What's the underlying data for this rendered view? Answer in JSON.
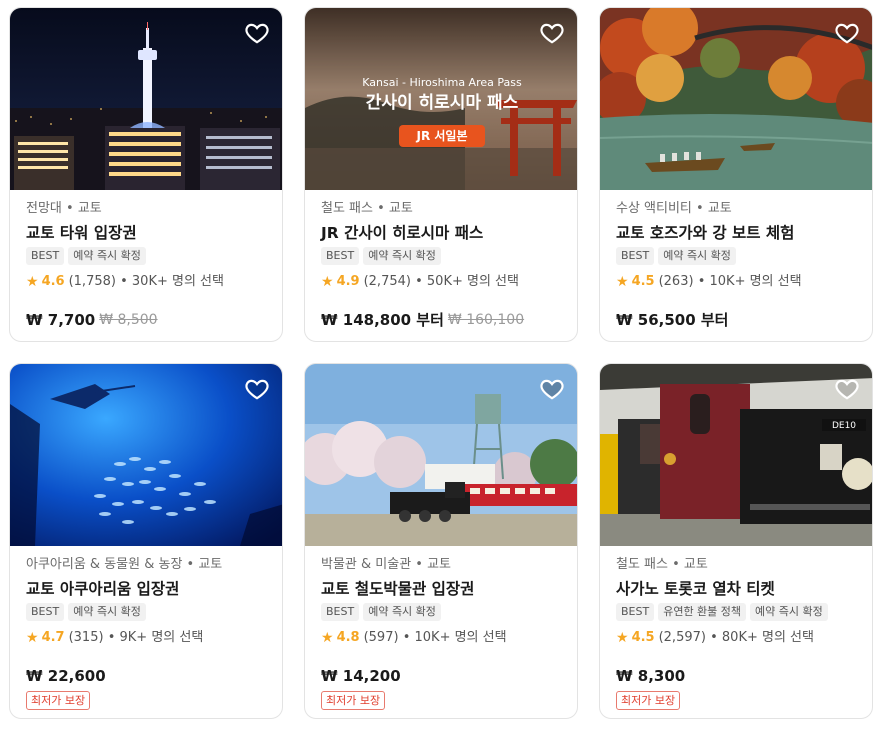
{
  "cards": [
    {
      "category": "전망대 • 교토",
      "title": "교토 타워 입장권",
      "tags": [
        "BEST",
        "예약 즉시 확정"
      ],
      "rating": "4.6",
      "reviews": "(1,758)",
      "chosen": "• 30K+ 명의 선택",
      "price": "₩ 7,700",
      "old_price": "₩ 8,500",
      "badge": ""
    },
    {
      "category": "철도 패스 • 교토",
      "title": "JR 간사이 히로시마 패스",
      "tags": [
        "BEST",
        "예약 즉시 확정"
      ],
      "rating": "4.9",
      "reviews": "(2,754)",
      "chosen": "• 50K+ 명의 선택",
      "price": "₩ 148,800 부터",
      "old_price": "₩ 160,100",
      "badge": "",
      "image_text": {
        "subtitle": "Kansai - Hiroshima Area Pass",
        "headline": "간사이 히로시마 패스",
        "pill": "JR 서일본"
      }
    },
    {
      "category": "수상 액티비티 • 교토",
      "title": "교토 호즈가와 강 보트 체험",
      "tags": [
        "BEST",
        "예약 즉시 확정"
      ],
      "rating": "4.5",
      "reviews": "(263)",
      "chosen": "• 10K+ 명의 선택",
      "price": "₩ 56,500 부터",
      "old_price": "",
      "badge": ""
    },
    {
      "category": "아쿠아리움 & 동물원 & 농장 • 교토",
      "title": "교토 아쿠아리움 입장권",
      "tags": [
        "BEST",
        "예약 즉시 확정"
      ],
      "rating": "4.7",
      "reviews": "(315)",
      "chosen": "• 9K+ 명의 선택",
      "price": "₩ 22,600",
      "old_price": "",
      "badge": "최저가 보장"
    },
    {
      "category": "박물관 & 미술관 • 교토",
      "title": "교토 철도박물관 입장권",
      "tags": [
        "BEST",
        "예약 즉시 확정"
      ],
      "rating": "4.8",
      "reviews": "(597)",
      "chosen": "• 10K+ 명의 선택",
      "price": "₩ 14,200",
      "old_price": "",
      "badge": "최저가 보장"
    },
    {
      "category": "철도 패스 • 교토",
      "title": "사가노 토롯코 열차 티켓",
      "tags": [
        "BEST",
        "유연한 환불 정책",
        "예약 즉시 확정"
      ],
      "rating": "4.5",
      "reviews": "(2,597)",
      "chosen": "• 80K+ 명의 선택",
      "price": "₩ 8,300",
      "old_price": "",
      "badge": "최저가 보장",
      "image_text": {
        "train_plate": "DE10"
      }
    }
  ],
  "icons": {
    "wishlist": "heart-outline-icon",
    "rating": "star-icon"
  },
  "colors": {
    "star": "#f5a623",
    "badge": "#e03e2d",
    "pill": "#e8541e"
  }
}
